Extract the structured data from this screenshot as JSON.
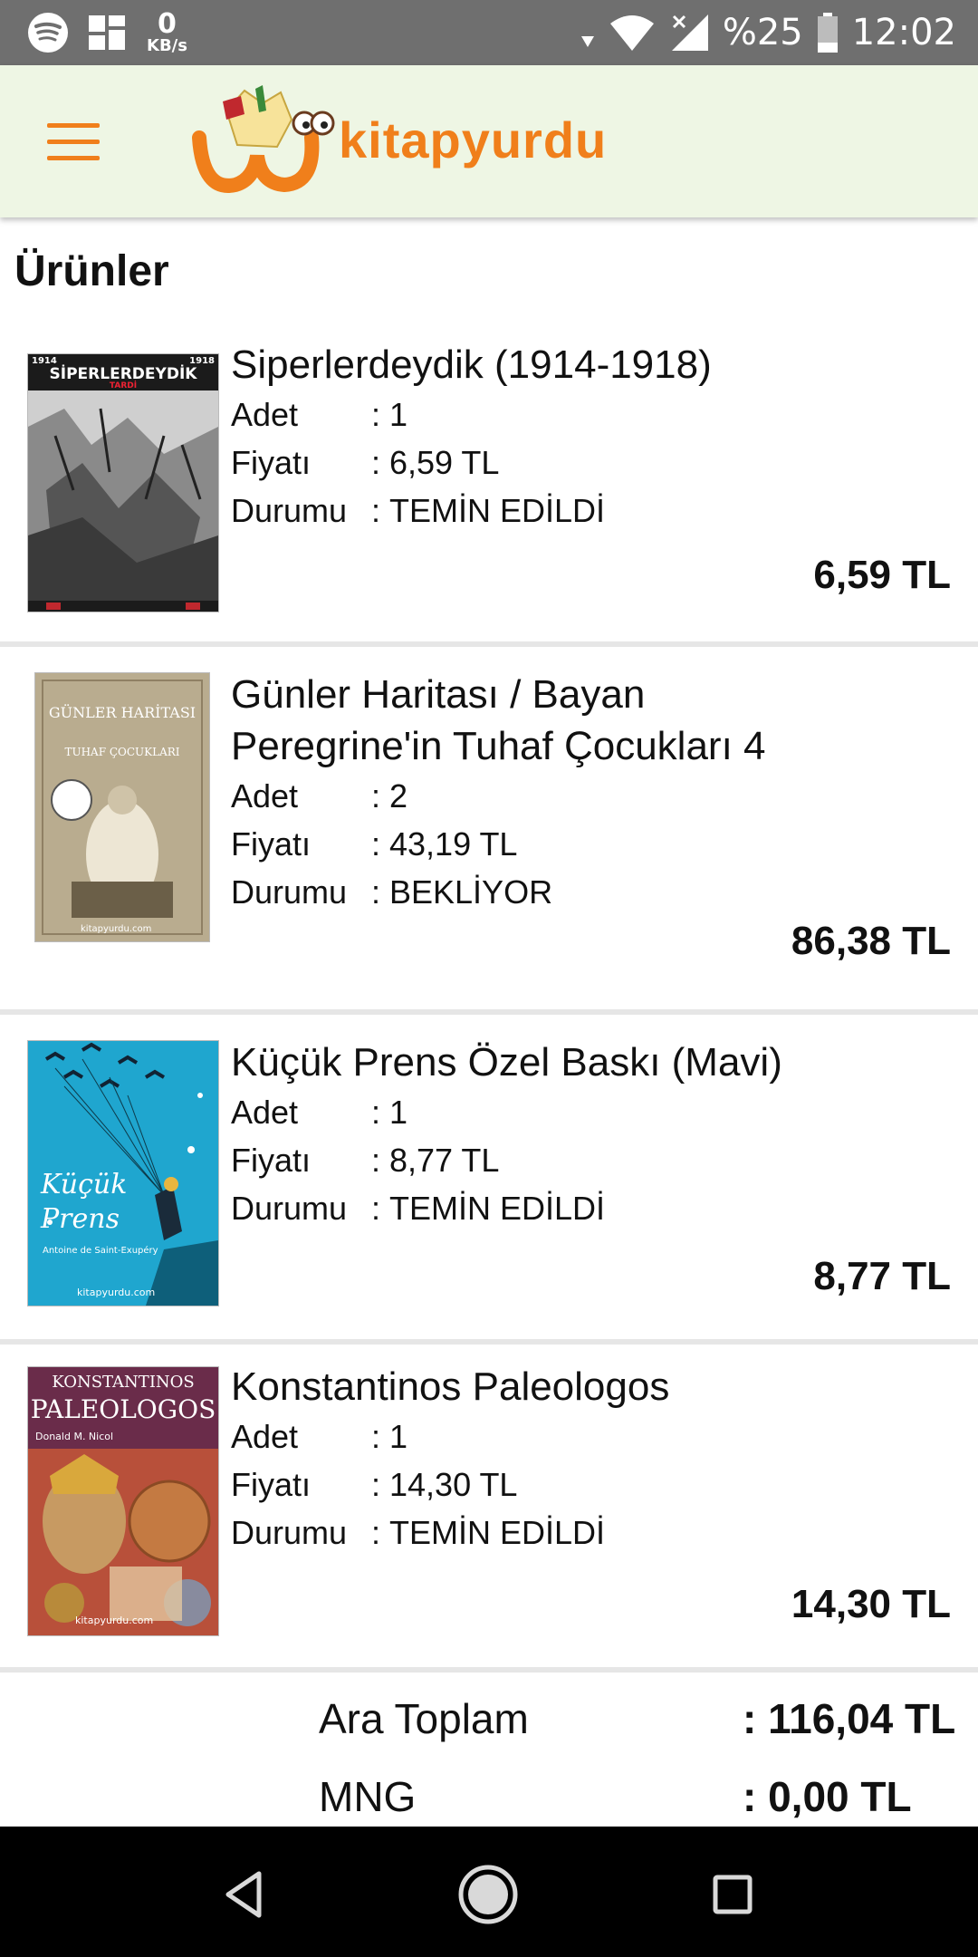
{
  "status_bar": {
    "speed_value": "0",
    "speed_unit": "KB/s",
    "battery": "%25",
    "time": "12:02"
  },
  "app": {
    "logo_text": "kitapyurdu",
    "brand_color": "#f07f1b"
  },
  "section_title": "Ürünler",
  "labels": {
    "qty": "Adet",
    "price": "Fiyatı",
    "status": "Durumu",
    "colon": ":"
  },
  "products": [
    {
      "title": "Siperlerdeydik (1914-1918)",
      "qty": "1",
      "price": "6,59 TL",
      "status": "TEMİN EDİLDİ",
      "total": "6,59 TL",
      "cover_text": "SİPERLERDEYDİK",
      "cover_sub": "TARDİ",
      "cover_year_left": "1914",
      "cover_year_right": "1918"
    },
    {
      "title": "Günler Haritası / Bayan Peregrine'in Tuhaf Çocukları 4",
      "qty": "2",
      "price": "43,19 TL",
      "status": "BEKLİYOR",
      "total": "86,38 TL",
      "cover_text": "GÜNLER HARİTASI",
      "cover_sub": "TUHAF ÇOCUKLARI",
      "cover_site": "kitapyurdu.com"
    },
    {
      "title": "Küçük Prens Özel Baskı (Mavi)",
      "qty": "1",
      "price": "8,77 TL",
      "status": "TEMİN EDİLDİ",
      "total": "8,77 TL",
      "cover_text": "Küçük Prens",
      "cover_sub": "Antoine de Saint-Exupéry",
      "cover_site": "kitapyurdu.com"
    },
    {
      "title": "Konstantinos Paleologos",
      "qty": "1",
      "price": "14,30 TL",
      "status": "TEMİN EDİLDİ",
      "total": "14,30 TL",
      "cover_text": "KONSTANTINOS",
      "cover_sub": "PALEOLOGOS",
      "cover_author": "Donald M. Nicol",
      "cover_site": "kitapyurdu.com"
    }
  ],
  "summary": [
    {
      "label": "Ara Toplam",
      "value": ": 116,04 TL"
    },
    {
      "label": "MNG",
      "value": ": 0,00 TL"
    }
  ]
}
